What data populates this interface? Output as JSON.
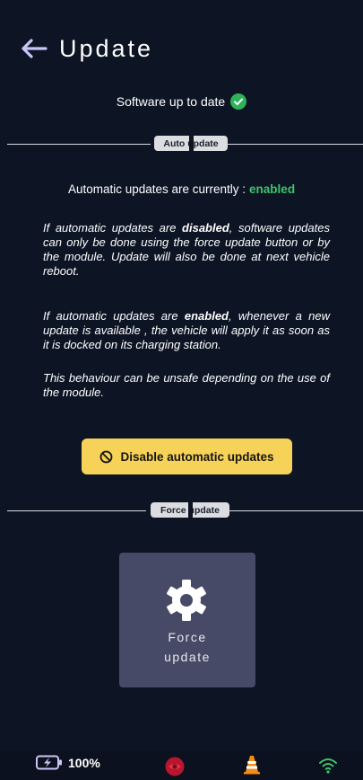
{
  "header": {
    "title": "Update"
  },
  "software_status": {
    "text": "Software up to date"
  },
  "auto_update": {
    "section_label": "Auto update",
    "status_prefix": "Automatic updates are currently :",
    "status_value": "enabled",
    "paragraph1_a": "If automatic updates are ",
    "paragraph1_b": "disabled",
    "paragraph1_c": ", software updates can only be done using the force update button or by the module. Update will also be done at next vehicle reboot.",
    "paragraph2_a": "If automatic updates are ",
    "paragraph2_b": "enabled",
    "paragraph2_c": ", whenever a new update is available , the vehicle will apply it as soon as it is docked on its charging station.",
    "paragraph3": "This behaviour can be unsafe depending on the use of the module.",
    "disable_button_label": "Disable automatic updates"
  },
  "force_update": {
    "section_label": "Force update",
    "button_label": "Force\nupdate"
  },
  "status_bar": {
    "battery": "100%"
  },
  "colors": {
    "background": "#0d1424",
    "enabled_green": "#3fc36a",
    "button_yellow": "#f6d258",
    "card": "#474a66"
  },
  "icons": [
    "back-arrow-icon",
    "check-circle-icon",
    "ban-icon",
    "gear-icon",
    "battery-charging-icon",
    "lidar-icon",
    "traffic-cone-icon",
    "wifi-icon"
  ]
}
